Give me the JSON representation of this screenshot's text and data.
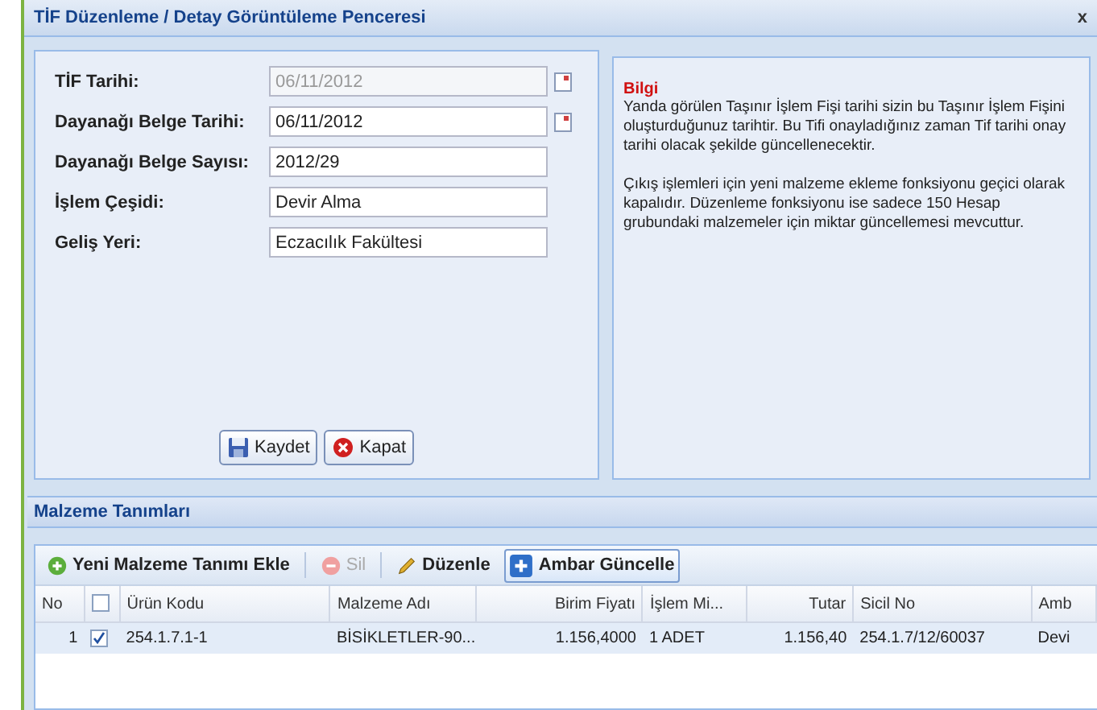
{
  "window": {
    "title": "TİF Düzenleme / Detay Görüntüleme Penceresi",
    "close": "x"
  },
  "form": {
    "fields": [
      {
        "label": "TİF Tarihi:",
        "value": "06/11/2012",
        "kind": "date",
        "disabled": true
      },
      {
        "label": "Dayanağı Belge Tarihi:",
        "value": "06/11/2012",
        "kind": "date",
        "disabled": false
      },
      {
        "label": "Dayanağı Belge Sayısı:",
        "value": "2012/29",
        "kind": "text",
        "disabled": false
      },
      {
        "label": "İşlem Çeşidi:",
        "value": "Devir Alma",
        "kind": "text",
        "disabled": false
      },
      {
        "label": "Geliş Yeri:",
        "value": "Eczacılık Fakültesi",
        "kind": "text",
        "disabled": false
      }
    ],
    "buttons": [
      {
        "label": "Kaydet",
        "kind": "save"
      },
      {
        "label": "Kapat",
        "kind": "close"
      }
    ]
  },
  "info": {
    "title": "Bilgi",
    "paragraphs": [
      "Yanda görülen Taşınır İşlem Fişi tarihi sizin bu Taşınır İşlem Fişini oluşturduğunuz tarihtir. Bu Tifi onayladığınız zaman Tif tarihi onay tarihi olacak şekilde güncellenecektir.",
      "Çıkış işlemleri için yeni malzeme ekleme fonksiyonu geçici olarak kapalıdır. Düzenleme fonksiyonu ise sadece 150 Hesap grubundaki malzemeler için miktar güncellemesi mevcuttur."
    ]
  },
  "materials": {
    "title": "Malzeme Tanımları",
    "toolbar": [
      {
        "label": "Yeni Malzeme Tanımı Ekle",
        "kind": "add",
        "disabled": false
      },
      {
        "label": "Sil",
        "kind": "delete",
        "disabled": true
      },
      {
        "label": "Düzenle",
        "kind": "edit",
        "disabled": false
      },
      {
        "label": "Ambar Güncelle",
        "kind": "update",
        "disabled": false
      }
    ],
    "columns": [
      {
        "label": "No",
        "kind": "number"
      },
      {
        "kind": "check",
        "checked": false
      },
      {
        "label": "Ürün Kodu",
        "kind": "text"
      },
      {
        "label": "Malzeme Adı",
        "kind": "text"
      },
      {
        "label": "Birim Fiyatı",
        "kind": "number"
      },
      {
        "label": "İşlem Mi...",
        "kind": "text"
      },
      {
        "label": "Tutar",
        "kind": "number"
      },
      {
        "label": "Sicil No",
        "kind": "text"
      },
      {
        "label": "Amb",
        "kind": "text"
      }
    ],
    "rows": [
      {
        "checked": true,
        "cells": [
          "1",
          "",
          "254.1.7.1-1",
          "BİSİKLETLER-90...",
          "1.156,4000",
          "1  ADET",
          "1.156,40",
          "254.1.7/12/60037",
          "Devi"
        ]
      }
    ]
  }
}
